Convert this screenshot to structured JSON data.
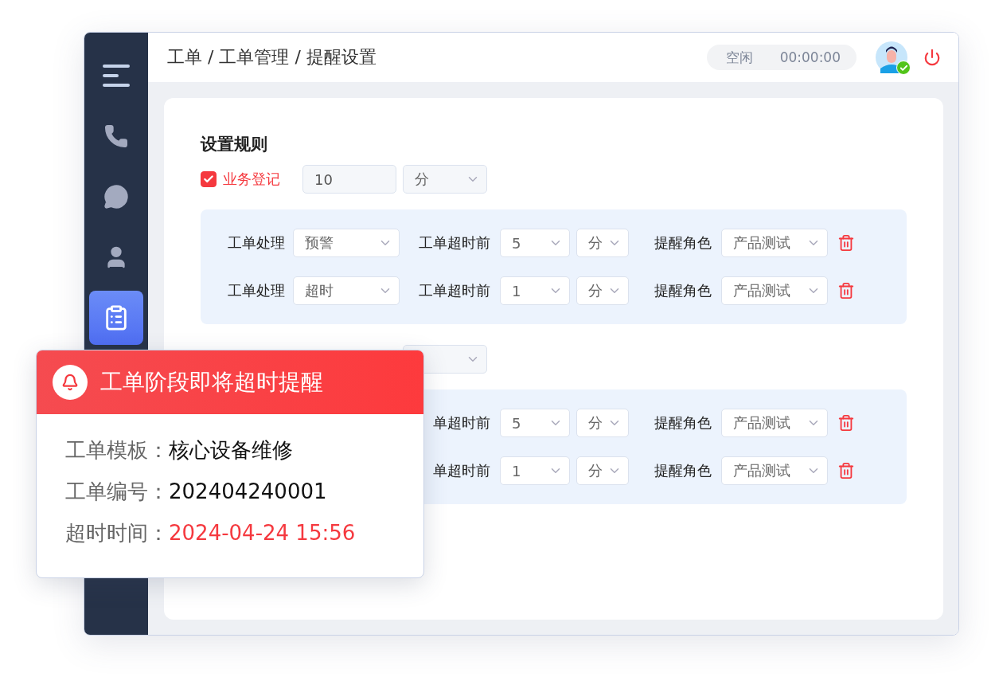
{
  "breadcrumb": "工单 / 工单管理 / 提醒设置",
  "status": {
    "state": "空闲",
    "timer": "00:00:00"
  },
  "sidebar": {
    "items": [
      {
        "kind": "menu",
        "selected": false
      },
      {
        "kind": "phone",
        "selected": false
      },
      {
        "kind": "chat",
        "selected": false
      },
      {
        "kind": "user",
        "selected": false
      },
      {
        "kind": "clipboard",
        "selected": true
      }
    ]
  },
  "settings": {
    "title": "设置规则",
    "rules": [
      {
        "checked": true,
        "color": "#f5393f",
        "label": "业务登记",
        "value": "10",
        "unit": "分",
        "rows": [
          {
            "stage_label": "工单处理",
            "stage": "预警",
            "before_label": "工单超时前",
            "amount": "5",
            "unit": "分",
            "role_label": "提醒角色",
            "role": "产品测试"
          },
          {
            "stage_label": "工单处理",
            "stage": "超时",
            "before_label": "工单超时前",
            "amount": "1",
            "unit": "分",
            "role_label": "提醒角色",
            "role": "产品测试"
          }
        ]
      },
      {
        "rows": [
          {
            "before_label": "单超时前",
            "amount": "5",
            "unit": "分",
            "role_label": "提醒角色",
            "role": "产品测试"
          },
          {
            "before_label": "单超时前",
            "amount": "1",
            "unit": "分",
            "role_label": "提醒角色",
            "role": "产品测试"
          }
        ]
      }
    ]
  },
  "popup": {
    "title": "工单阶段即将超时提醒",
    "fields": [
      {
        "kind": "normal",
        "label": "工单模板：",
        "value": "核心设备维修"
      },
      {
        "kind": "normal",
        "label": "工单编号：",
        "value": "202404240001"
      },
      {
        "kind": "alert",
        "label": "超时时间：",
        "value": "2024-04-24 15:56"
      }
    ]
  }
}
